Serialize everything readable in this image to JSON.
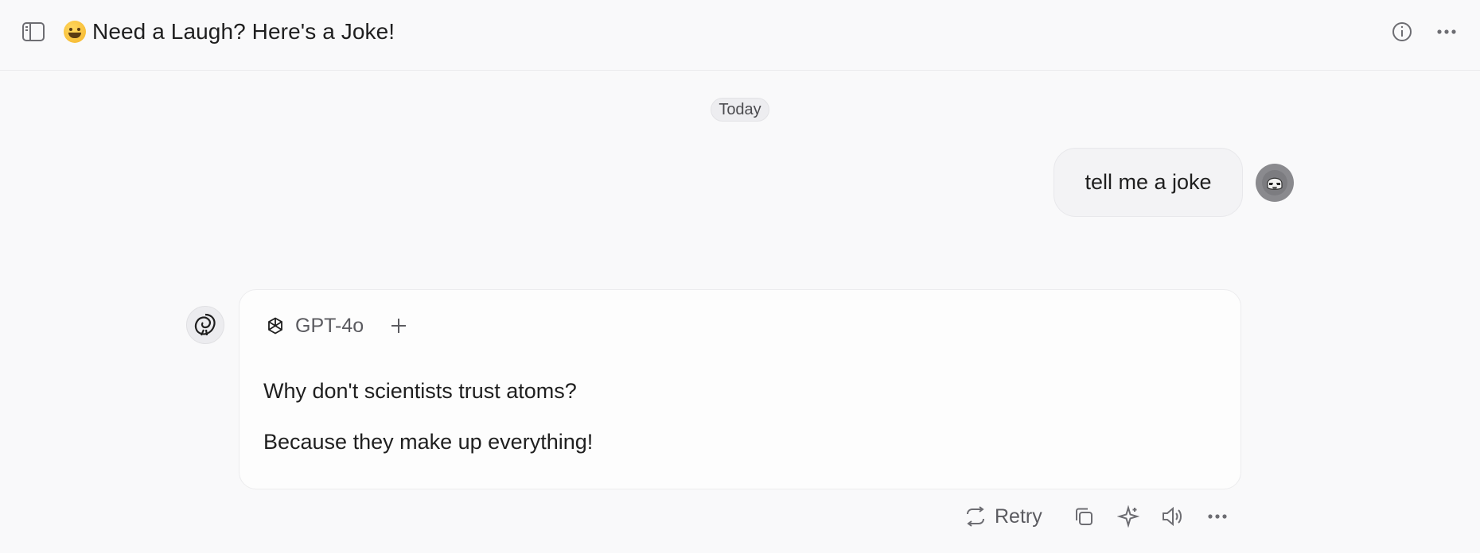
{
  "header": {
    "title": "Need a Laugh? Here's a Joke!",
    "title_emoji": "grinning-face-emoji",
    "icons": {
      "sidebar": "sidebar-toggle-icon",
      "info": "info-icon",
      "more": "more-horizontal-icon"
    }
  },
  "chat": {
    "date_separator": "Today",
    "user_message": "tell me a joke",
    "user_avatar": "stormtrooper-avatar",
    "assistant": {
      "avatar": "assistant-logo-icon",
      "model_icon": "openai-icon",
      "model_name": "GPT-4o",
      "add_model_icon": "plus-icon",
      "lines": [
        "Why don't scientists trust atoms?",
        "Because they make up everything!"
      ]
    },
    "actions": {
      "retry_label": "Retry",
      "icons": [
        "retry-icon",
        "copy-icon",
        "sparkle-icon",
        "speaker-icon",
        "more-horizontal-icon"
      ]
    }
  },
  "colors": {
    "background": "#f9f9fa",
    "text": "#1f1f1f",
    "muted_text": "#5b5b60",
    "bubble": "#f3f3f5",
    "card": "#fdfdfd"
  }
}
